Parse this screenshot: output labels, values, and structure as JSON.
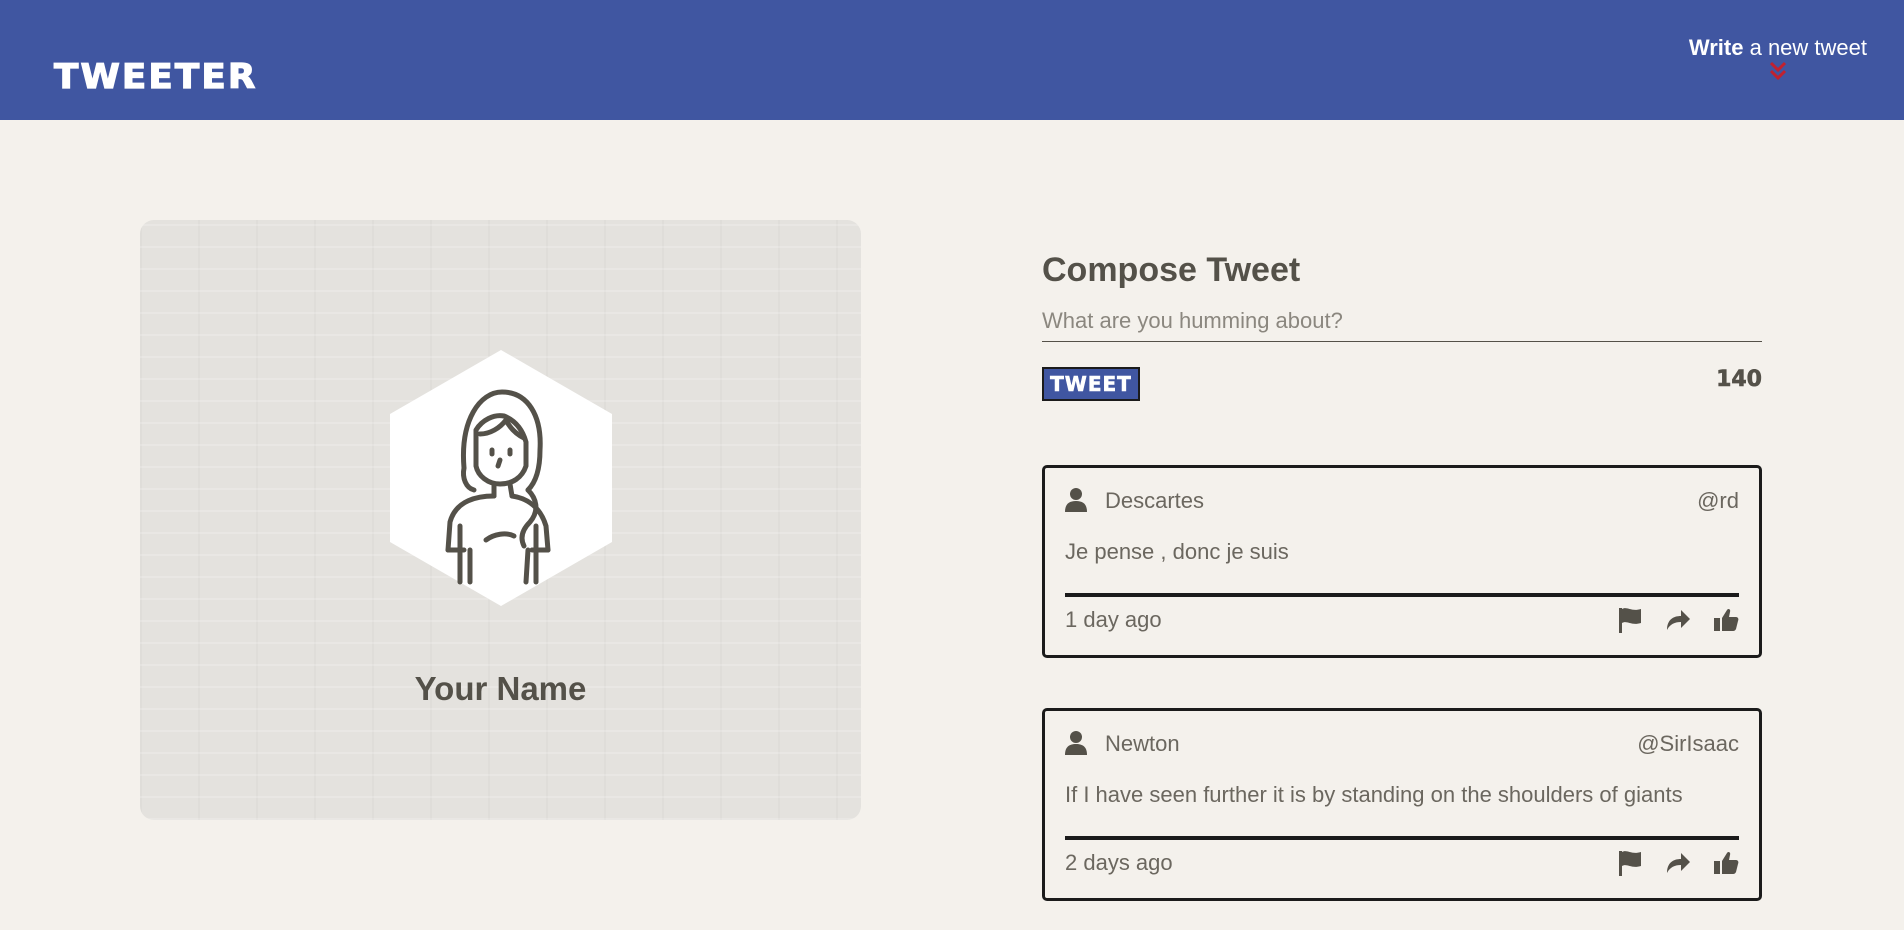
{
  "navbar": {
    "logo": "TWEETER",
    "write_bold": "Write",
    "write_rest": " a new tweet",
    "background": "#4056a1",
    "chevron_color": "#c1212f"
  },
  "profile": {
    "name": "Your Name",
    "avatar_icon": "woman-avatar-icon"
  },
  "compose": {
    "title": "Compose Tweet",
    "placeholder": "What are you humming about?",
    "button_label": "TWEET",
    "counter": "140"
  },
  "tweets": [
    {
      "author": "Descartes",
      "handle": "@rd",
      "content": "Je pense , donc je suis",
      "time": "1 day ago"
    },
    {
      "author": "Newton",
      "handle": "@SirIsaac",
      "content": "If I have seen further it is by standing on the shoulders of giants",
      "time": "2 days ago"
    }
  ],
  "colors": {
    "background": "#f4f1ec",
    "text": "#545149",
    "accent": "#4056a1"
  }
}
